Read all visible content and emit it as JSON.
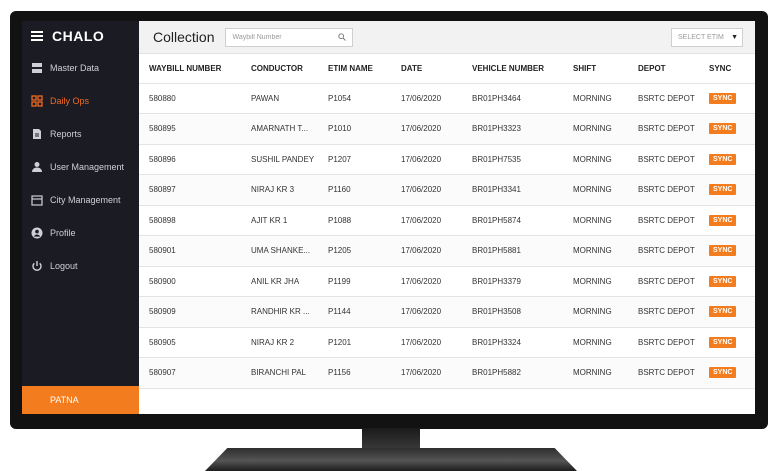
{
  "app": {
    "brand": "CHALO"
  },
  "sidebar": {
    "items": [
      {
        "label": "Master Data",
        "icon": "database-icon"
      },
      {
        "label": "Daily Ops",
        "icon": "grid-icon",
        "active": true
      },
      {
        "label": "Reports",
        "icon": "document-icon"
      },
      {
        "label": "User Management",
        "icon": "user-icon"
      },
      {
        "label": "City Management",
        "icon": "calendar-icon"
      },
      {
        "label": "Profile",
        "icon": "profile-icon"
      },
      {
        "label": "Logout",
        "icon": "power-icon"
      }
    ],
    "city": "PATNA"
  },
  "header": {
    "title": "Collection",
    "search_placeholder": "Waybill Number",
    "select_label": "SELECT ETIM"
  },
  "table": {
    "columns": [
      "WAYBILL NUMBER",
      "CONDUCTOR",
      "ETIM NAME",
      "DATE",
      "VEHICLE NUMBER",
      "SHIFT",
      "DEPOT",
      "SYNC"
    ],
    "sync_label": "SYNC",
    "rows": [
      [
        "580880",
        "PAWAN",
        "P1054",
        "17/06/2020",
        "BR01PH3464",
        "MORNING",
        "BSRTC DEPOT"
      ],
      [
        "580895",
        "AMARNATH T...",
        "P1010",
        "17/06/2020",
        "BR01PH3323",
        "MORNING",
        "BSRTC DEPOT"
      ],
      [
        "580896",
        "SUSHIL PANDEY",
        "P1207",
        "17/06/2020",
        "BR01PH7535",
        "MORNING",
        "BSRTC DEPOT"
      ],
      [
        "580897",
        "NIRAJ KR 3",
        "P1160",
        "17/06/2020",
        "BR01PH3341",
        "MORNING",
        "BSRTC DEPOT"
      ],
      [
        "580898",
        "AJIT KR 1",
        "P1088",
        "17/06/2020",
        "BR01PH5874",
        "MORNING",
        "BSRTC DEPOT"
      ],
      [
        "580901",
        "UMA SHANKE...",
        "P1205",
        "17/06/2020",
        "BR01PH5881",
        "MORNING",
        "BSRTC DEPOT"
      ],
      [
        "580900",
        "ANIL KR JHA",
        "P1199",
        "17/06/2020",
        "BR01PH3379",
        "MORNING",
        "BSRTC DEPOT"
      ],
      [
        "580909",
        "RANDHIR KR ...",
        "P1144",
        "17/06/2020",
        "BR01PH3508",
        "MORNING",
        "BSRTC DEPOT"
      ],
      [
        "580905",
        "NIRAJ KR 2",
        "P1201",
        "17/06/2020",
        "BR01PH3324",
        "MORNING",
        "BSRTC DEPOT"
      ],
      [
        "580907",
        "BIRANCHI PAL",
        "P1156",
        "17/06/2020",
        "BR01PH5882",
        "MORNING",
        "BSRTC DEPOT"
      ]
    ]
  },
  "colors": {
    "accent": "#f27c1e",
    "sidebar_bg": "#1b1b24",
    "active_text": "#f26a21"
  }
}
